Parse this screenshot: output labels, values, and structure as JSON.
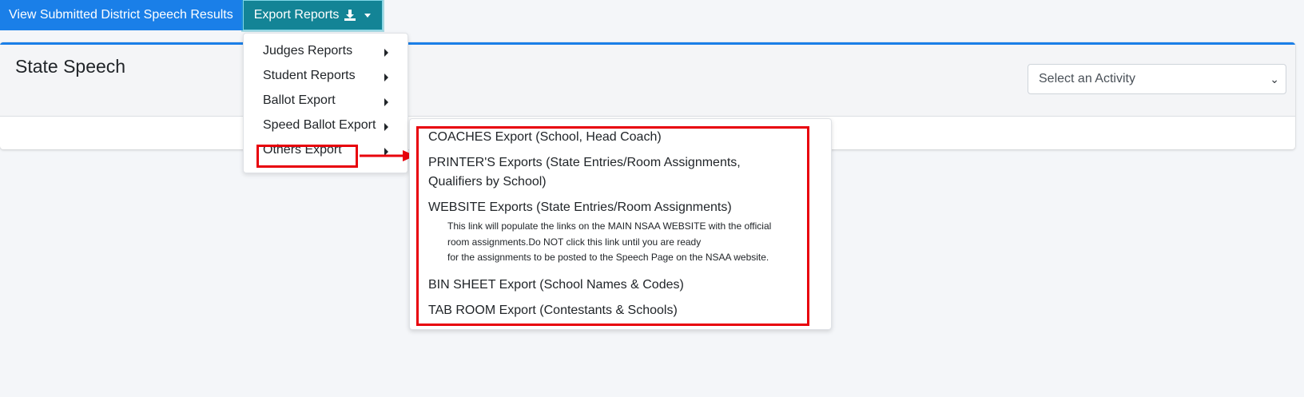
{
  "toolbar": {
    "view_label": "View Submitted District Speech Results",
    "export_label": "Export Reports"
  },
  "header": {
    "title": "State Speech",
    "activity_select": "Select an Activity"
  },
  "export_menu": {
    "items": [
      "Judges Reports",
      "Student Reports",
      "Ballot Export",
      "Speed Ballot Export",
      "Others Export"
    ]
  },
  "others_submenu": {
    "items": [
      "COACHES Export (School, Head Coach)",
      "PRINTER'S Exports (State Entries/Room Assignments,",
      "Qualifiers by School)",
      "WEBSITE Exports (State Entries/Room Assignments)",
      "BIN SHEET Export (School Names & Codes)",
      "TAB ROOM Export (Contestants & Schools)"
    ],
    "website_note": [
      "This link will populate the links on the MAIN NSAA WEBSITE with the official",
      "room assignments.Do NOT click this link until you are ready",
      "for the assignments to be posted to the Speech Page on the NSAA website."
    ]
  },
  "colors": {
    "primary": "#1a7fe8",
    "export_button": "#138496",
    "annotation_red": "#e8000b"
  }
}
